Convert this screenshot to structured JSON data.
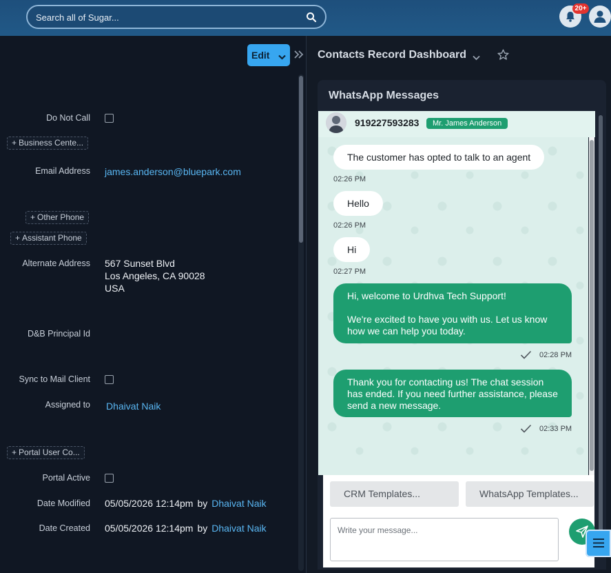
{
  "topbar": {
    "search_placeholder": "Search all of Sugar...",
    "notification_count": "20+"
  },
  "record": {
    "edit_label": "Edit",
    "fields": {
      "do_not_call": {
        "label": "Do Not Call",
        "checked": false
      },
      "business_center": {
        "label": "Business Cente..."
      },
      "email": {
        "label": "Email Address",
        "value": "james.anderson@bluepark.com"
      },
      "other_phone": {
        "label": "Other Phone"
      },
      "assistant_phone": {
        "label": "Assistant Phone"
      },
      "alternate_address": {
        "label": "Alternate Address",
        "line1": "567 Sunset Blvd",
        "line2": "Los Angeles, CA 90028",
        "line3": "USA"
      },
      "dnb_principal": {
        "label": "D&B Principal Id"
      },
      "sync_mail": {
        "label": "Sync to Mail Client",
        "checked": false
      },
      "assigned_to": {
        "label": "Assigned to",
        "value": "Dhaivat Naik"
      },
      "portal_user": {
        "label": "Portal User Co..."
      },
      "portal_active": {
        "label": "Portal Active",
        "checked": false
      },
      "date_modified": {
        "label": "Date Modified",
        "value": "05/05/2026 12:14pm",
        "by": "by",
        "user": "Dhaivat Naik"
      },
      "date_created": {
        "label": "Date Created",
        "value": "05/05/2026 12:14pm",
        "by": "by",
        "user": "Dhaivat Naik"
      }
    }
  },
  "dashboard": {
    "title": "Contacts Record Dashboard",
    "dashlet_title": "WhatsApp Messages",
    "contact_phone": "919227593283",
    "contact_name": "Mr. James Anderson",
    "messages": [
      {
        "direction": "in",
        "text": "The customer has opted to talk to an agent",
        "time": "02:26 PM"
      },
      {
        "direction": "in",
        "text": "Hello",
        "time": "02:26 PM"
      },
      {
        "direction": "in",
        "text": "Hi",
        "time": "02:27 PM"
      },
      {
        "direction": "out",
        "text1": "Hi, welcome to Urdhva Tech Support!",
        "text2": "We're excited to have you with us. Let us know how we can help you today.",
        "time": "02:28 PM"
      },
      {
        "direction": "out",
        "text1": "Thank you for contacting us! The chat session has ended. If you need further assistance, please send a new message.",
        "time": "02:33 PM"
      }
    ],
    "crm_templates": "CRM Templates...",
    "wa_templates": "WhatsApp Templates...",
    "compose_placeholder": "Write your message..."
  },
  "colors": {
    "accent": "#37a6f0",
    "whatsapp_green": "#1e9e70",
    "link": "#59b6f2"
  }
}
